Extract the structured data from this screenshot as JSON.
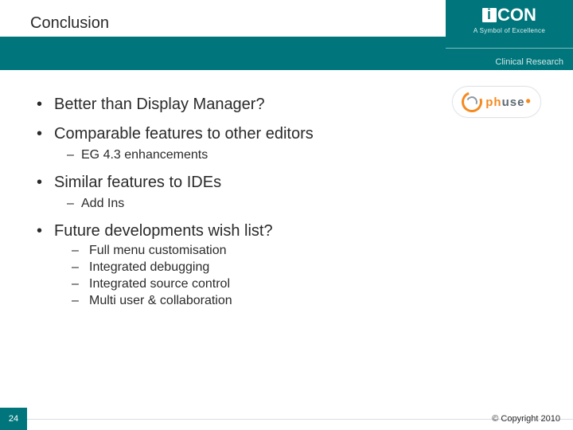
{
  "header": {
    "title": "Conclusion",
    "logo": {
      "main": "CON",
      "tagline": "A Symbol of Excellence",
      "sub": "Clinical Research"
    }
  },
  "badge": {
    "ph": "ph",
    "use": "use"
  },
  "bullets": {
    "b1": "Better than Display Manager?",
    "b2": "Comparable features to other editors",
    "b2s1": "EG 4.3 enhancements",
    "b3": "Similar features to IDEs",
    "b3s1": "Add Ins",
    "b4": "Future developments wish list?",
    "b4s1": "Full menu customisation",
    "b4s2": "Integrated debugging",
    "b4s3": "Integrated source control",
    "b4s4": "Multi user & collaboration"
  },
  "footer": {
    "page": "24",
    "copyright": "© Copyright 2010"
  }
}
